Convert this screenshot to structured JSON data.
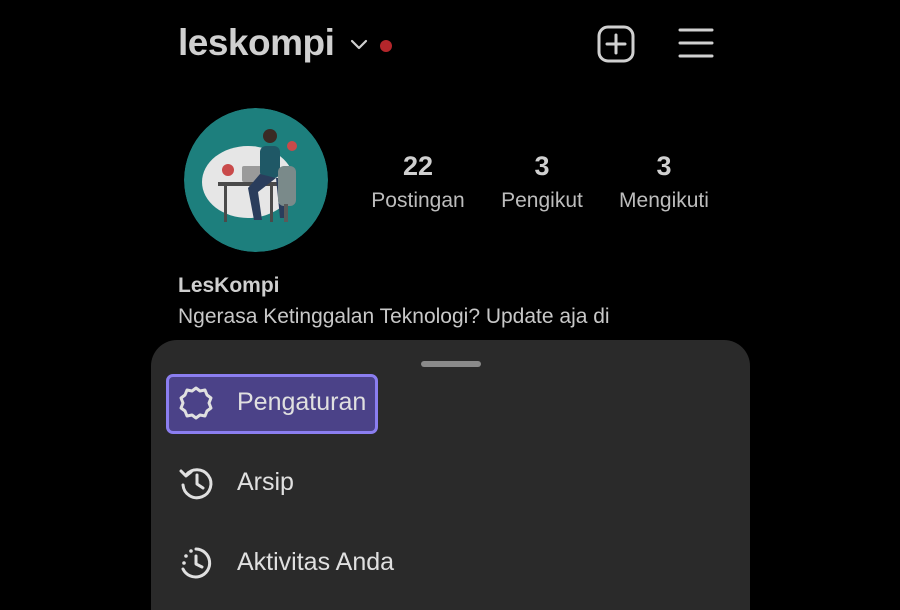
{
  "header": {
    "username": "leskompi",
    "notification_dot_color": "#b3262b",
    "add_icon": "plus-square-icon",
    "menu_icon": "hamburger-menu-icon"
  },
  "profile": {
    "avatar": "illustration-person-at-laptop",
    "stats": [
      {
        "value": "22",
        "label": "Postingan"
      },
      {
        "value": "3",
        "label": "Pengikut"
      },
      {
        "value": "3",
        "label": "Mengikuti"
      }
    ],
    "name": "LesKompi",
    "bio": "Ngerasa Ketinggalan Teknologi? Update aja di"
  },
  "sheet": {
    "items": [
      {
        "label": "Pengaturan",
        "icon": "settings-gear-icon",
        "highlighted": true
      },
      {
        "label": "Arsip",
        "icon": "archive-history-icon"
      },
      {
        "label": "Aktivitas Anda",
        "icon": "activity-clock-icon"
      }
    ],
    "highlight_color": "#8b7ef0"
  }
}
